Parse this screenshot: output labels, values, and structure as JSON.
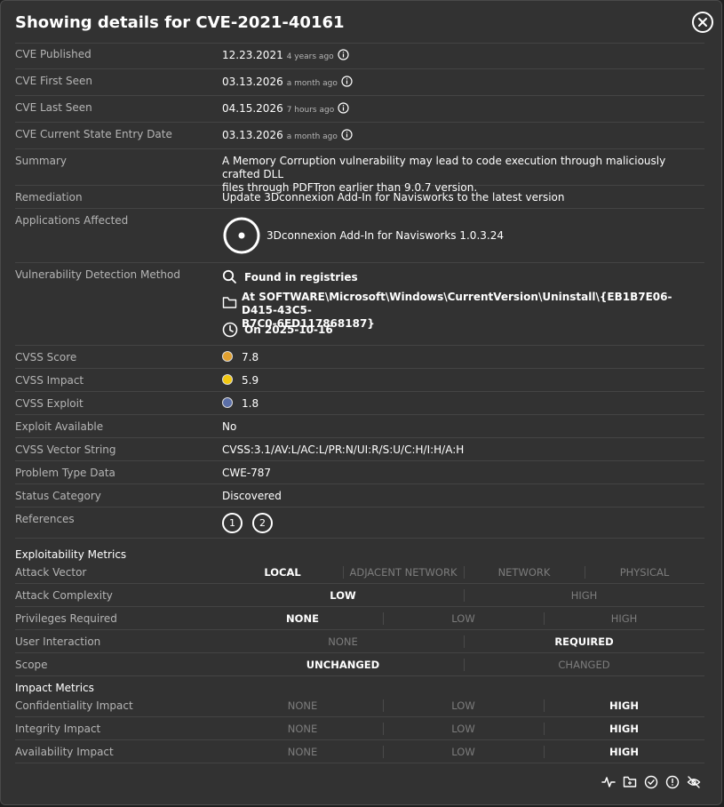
{
  "title": "Showing details for CVE-2021-40161",
  "fields": {
    "published": {
      "label": "CVE Published",
      "date": "12.23.2021",
      "ago": "4 years ago"
    },
    "first_seen": {
      "label": "CVE First Seen",
      "date": "03.13.2026",
      "ago": "a month ago"
    },
    "last_seen": {
      "label": "CVE Last Seen",
      "date": "04.15.2026",
      "ago": "7 hours ago"
    },
    "current_state": {
      "label": "CVE Current State Entry Date",
      "date": "03.13.2026",
      "ago": "a month ago"
    },
    "summary": {
      "label": "Summary",
      "line1": "A Memory Corruption vulnerability may lead to code execution through maliciously crafted DLL",
      "line2": "files through PDFTron earlier than 9.0.7 version."
    },
    "remediation": {
      "label": "Remediation",
      "value": "Update 3Dconnexion Add-In for Navisworks to the latest version"
    },
    "applications": {
      "label": "Applications Affected",
      "value": "3Dconnexion Add-In for Navisworks 1.0.3.24"
    },
    "detection": {
      "label": "Vulnerability Detection Method",
      "found": "Found in registries",
      "path1": "At SOFTWARE\\Microsoft\\Windows\\CurrentVersion\\Uninstall\\{EB1B7E06-D415-43C5-",
      "path2": "B7C0-6ED117868187}",
      "date": "On 2025-10-16"
    },
    "cvss_score": {
      "label": "CVSS Score",
      "value": "7.8",
      "color": "#e0a030"
    },
    "cvss_impact": {
      "label": "CVSS Impact",
      "value": "5.9",
      "color": "#f2c811"
    },
    "cvss_exploit": {
      "label": "CVSS Exploit",
      "value": "1.8",
      "color": "#5b6fa8"
    },
    "exploit_available": {
      "label": "Exploit Available",
      "value": "No"
    },
    "vector": {
      "label": "CVSS Vector String",
      "value": "CVSS:3.1/AV:L/AC:L/PR:N/UI:R/S:U/C:H/I:H/A:H"
    },
    "problem_type": {
      "label": "Problem Type Data",
      "value": "CWE-787"
    },
    "status": {
      "label": "Status Category",
      "value": "Discovered"
    },
    "references": {
      "label": "References",
      "items": [
        "1",
        "2"
      ]
    }
  },
  "exploitability": {
    "title": "Exploitability Metrics",
    "attack_vector": {
      "label": "Attack Vector",
      "options": [
        "LOCAL",
        "ADJACENT NETWORK",
        "NETWORK",
        "PHYSICAL"
      ],
      "selected": "LOCAL"
    },
    "attack_complexity": {
      "label": "Attack Complexity",
      "options": [
        "LOW",
        "HIGH"
      ],
      "selected": "LOW"
    },
    "privileges": {
      "label": "Privileges Required",
      "options": [
        "NONE",
        "LOW",
        "HIGH"
      ],
      "selected": "NONE"
    },
    "user_interaction": {
      "label": "User Interaction",
      "options": [
        "NONE",
        "REQUIRED"
      ],
      "selected": "REQUIRED"
    },
    "scope": {
      "label": "Scope",
      "options": [
        "UNCHANGED",
        "CHANGED"
      ],
      "selected": "UNCHANGED"
    }
  },
  "impact": {
    "title": "Impact Metrics",
    "confidentiality": {
      "label": "Confidentiality Impact",
      "options": [
        "NONE",
        "LOW",
        "HIGH"
      ],
      "selected": "HIGH"
    },
    "integrity": {
      "label": "Integrity Impact",
      "options": [
        "NONE",
        "LOW",
        "HIGH"
      ],
      "selected": "HIGH"
    },
    "availability": {
      "label": "Availability Impact",
      "options": [
        "NONE",
        "LOW",
        "HIGH"
      ],
      "selected": "HIGH"
    }
  },
  "footer_icons": [
    "activity-icon",
    "folder-icon",
    "check-circle-icon",
    "alert-circle-icon",
    "eye-off-icon"
  ]
}
